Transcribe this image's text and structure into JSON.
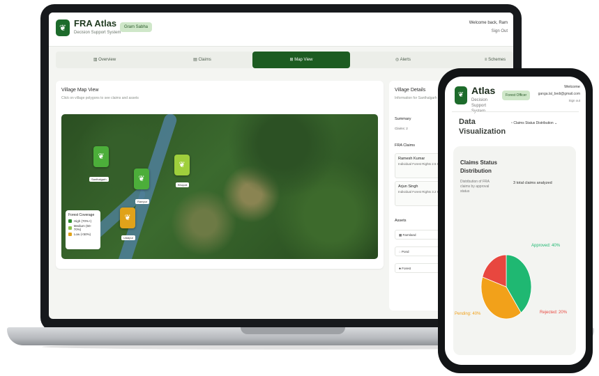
{
  "desktop": {
    "app_title": "FRA Atlas",
    "app_subtitle": "Decision Support System",
    "role_badge": "Gram Sabha",
    "welcome": "Welcome back, Ram",
    "logout": "Sign Out",
    "tabs": [
      {
        "label": "Overview",
        "icon": "chart-icon",
        "active": false
      },
      {
        "label": "Claims",
        "icon": "file-icon",
        "active": false
      },
      {
        "label": "Map View",
        "icon": "map-icon",
        "active": true
      },
      {
        "label": "Alerts",
        "icon": "bell-icon",
        "active": false
      },
      {
        "label": "Schemes",
        "icon": "list-icon",
        "active": false
      }
    ],
    "map_card": {
      "title": "Village Map View",
      "subtitle": "Click on village polygons to see claims and assets",
      "villages": [
        {
          "label": "Santhalgarh",
          "color": "green"
        },
        {
          "label": "Rampur",
          "color": "green"
        },
        {
          "label": "Bhopali",
          "color": "lime"
        },
        {
          "label": "Udaipur",
          "color": "yellow"
        }
      ],
      "legend": {
        "title": "Forest Coverage",
        "items": [
          {
            "label": "High (70%+)",
            "color": "#2e8b2e"
          },
          {
            "label": "Medium (50-70%)",
            "color": "#8bc34a"
          },
          {
            "label": "Low (<50%)",
            "color": "#e0a21a"
          }
        ]
      }
    },
    "side_card": {
      "title": "Village Details",
      "subtitle": "Information for Santhalgarh",
      "summary_h": "Summary",
      "summary_t": "Claims: 2",
      "claims_h": "FRA Claims",
      "claims": [
        {
          "name": "Ramesh Kumar",
          "detail": "Individual Forest Rights 2.5 Hectares"
        },
        {
          "name": "Arjun Singh",
          "detail": "Individual Forest Rights 3.2 Hectares"
        }
      ],
      "assets_h": "Assets",
      "assets": [
        "Farmland",
        "Pond",
        "Forest"
      ]
    }
  },
  "phone": {
    "app_title": "Atlas",
    "app_subtitle": "Decision Support System",
    "role_badge": "Forest Officer",
    "welcome": "Welcome",
    "user": "ganga.lal_bedi@gmail.com",
    "logout": "Sign out",
    "section_title": "Data Visualization",
    "select_label": "Claims Status Distribution",
    "card_title": "Claims Status Distribution",
    "card_sub": "Distribution of FRA claims by approval status",
    "claims_count": "3 total claims analyzed",
    "chart_data": {
      "type": "pie",
      "categories": [
        "Approved",
        "Pending",
        "Rejected"
      ],
      "values": [
        40,
        40,
        20
      ],
      "colors": [
        "#1fb872",
        "#f2a11a",
        "#e8473f"
      ],
      "labels": [
        "Approved: 40%",
        "Pending: 40%",
        "Rejected: 20%"
      ]
    }
  }
}
